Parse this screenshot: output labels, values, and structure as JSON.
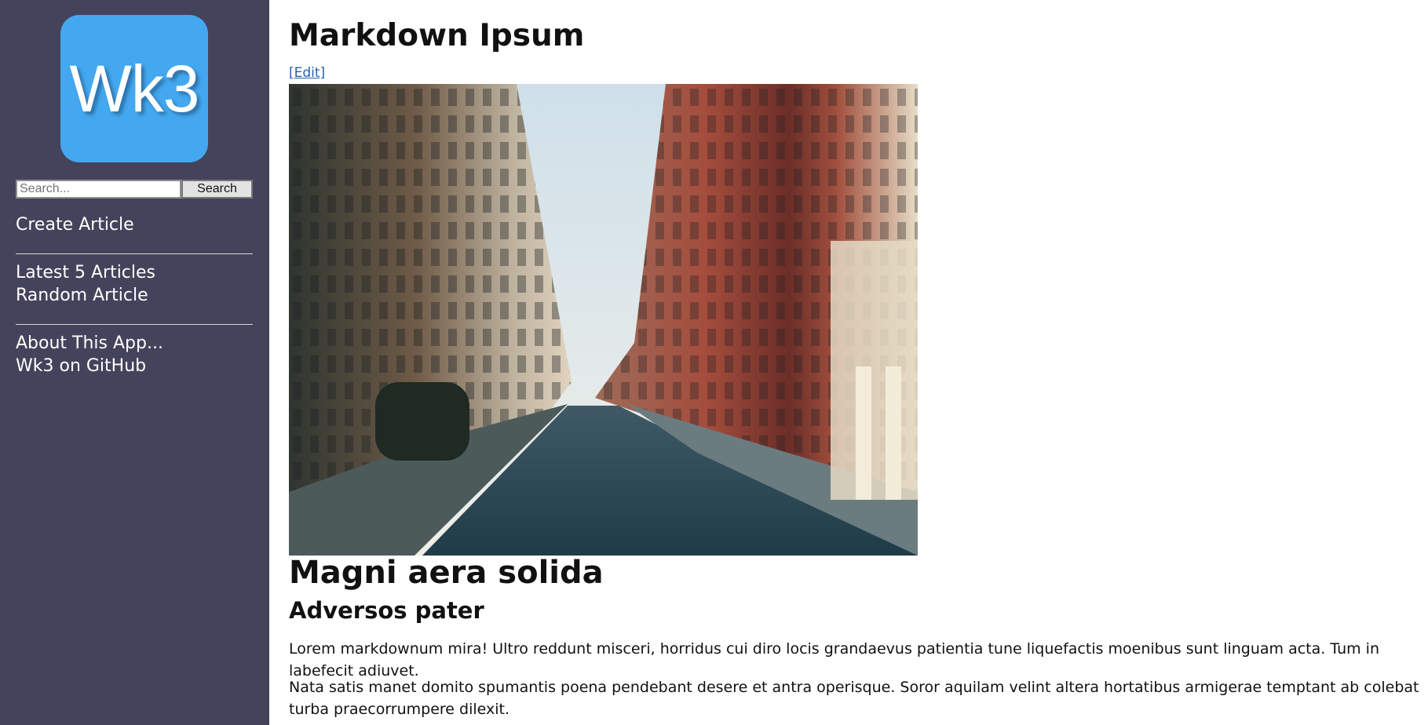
{
  "sidebar": {
    "logo_text": "Wk3",
    "search": {
      "placeholder": "Search...",
      "button": "Search"
    },
    "links": {
      "create": "Create Article",
      "latest": "Latest 5 Articles",
      "random": "Random Article",
      "about": "About This App...",
      "github": "Wk3 on GitHub"
    }
  },
  "article": {
    "title": "Markdown Ipsum",
    "edit_label": "[Edit]",
    "image_alt": "city street",
    "heading1": "Magni aera solida",
    "heading2": "Adversos pater",
    "paragraph1": "Lorem markdownum mira! Ultro reddunt misceri, horridus cui diro locis grandaevus patientia tune liquefactis moenibus sunt linguam acta. Tum in labefecit adiuvet.",
    "paragraph2": "Nata satis manet domito spumantis poena pendebant desere et antra operisque. Soror aquilam velint altera hortatibus armigerae temptant ab colebat turba praecorrumpere dilexit."
  },
  "colors": {
    "sidebar_bg": "#45435b",
    "logo_bg": "#43a8ef",
    "link": "#2760b5"
  }
}
